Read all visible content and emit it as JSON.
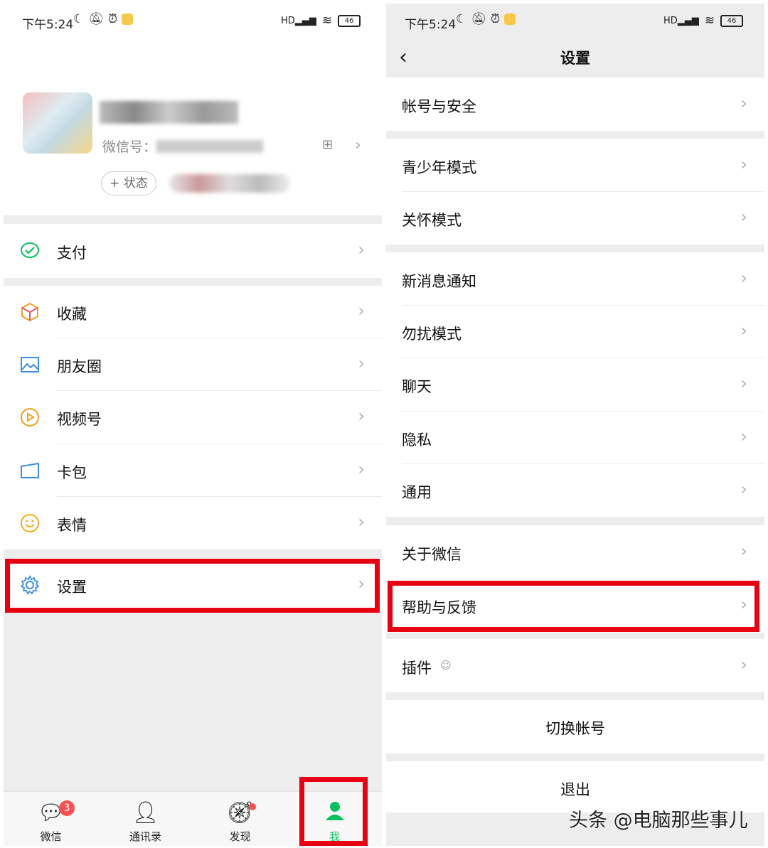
{
  "status_bar": {
    "time": "下午5:24",
    "battery": "46",
    "hd": "HD"
  },
  "left": {
    "profile": {
      "wxid_label": "微信号：",
      "status_button": "+ 状态"
    },
    "menu": {
      "pay": "支付",
      "favorites": "收藏",
      "moments": "朋友圈",
      "channels": "视频号",
      "cards": "卡包",
      "stickers": "表情",
      "settings": "设置"
    },
    "tabbar": {
      "chats": "微信",
      "chats_badge": "3",
      "contacts": "通讯录",
      "discover": "发现",
      "me": "我"
    }
  },
  "right": {
    "title": "设置",
    "items": {
      "account_security": "帐号与安全",
      "teen_mode": "青少年模式",
      "care_mode": "关怀模式",
      "notifications": "新消息通知",
      "dnd": "勿扰模式",
      "chat": "聊天",
      "privacy": "隐私",
      "general": "通用",
      "about": "关于微信",
      "help_feedback": "帮助与反馈",
      "plugins": "插件",
      "switch_account": "切换帐号",
      "logout": "退出"
    }
  },
  "watermark": "头条 @电脑那些事儿",
  "colors": {
    "highlight": "#e60012",
    "wechat_green": "#07c160",
    "badge_red": "#fa5151"
  }
}
